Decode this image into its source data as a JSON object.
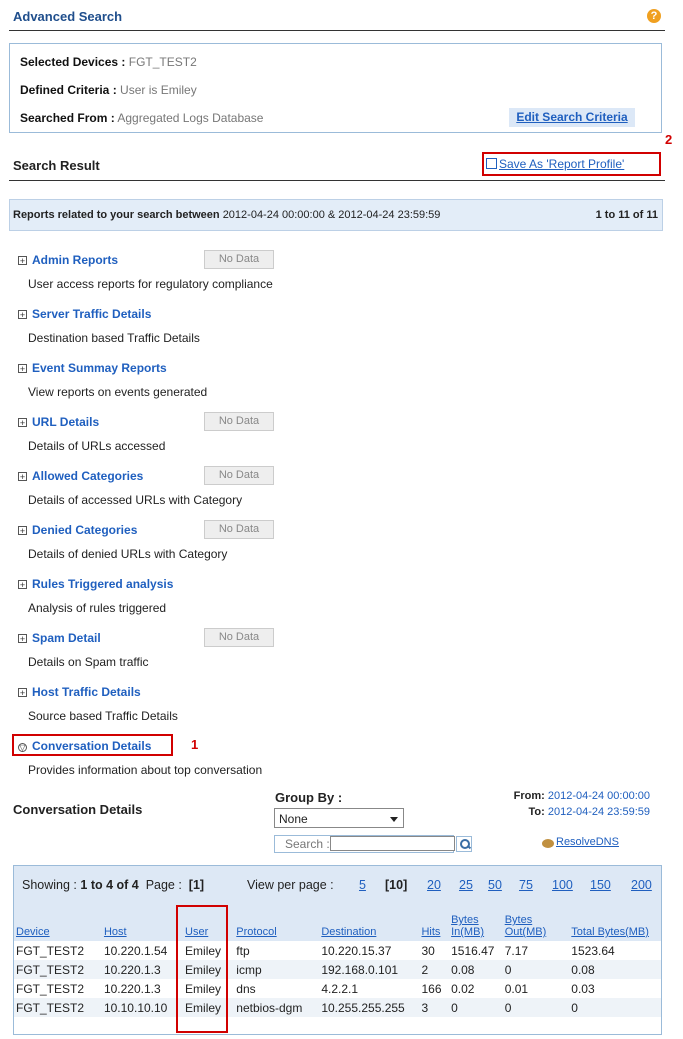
{
  "header": {
    "title": "Advanced Search",
    "help_icon": "?"
  },
  "criteria": {
    "devices_label": "Selected Devices :",
    "devices_value": "FGT_TEST2",
    "criteria_label": "Defined Criteria :",
    "criteria_value": "User is Emiley",
    "from_label": "Searched From :",
    "from_value": "Aggregated Logs Database",
    "edit_button": "Edit Search Criteria"
  },
  "search_result": {
    "title": "Search Result",
    "save_link": "Save  As  'Report  Profile'",
    "annotation_2": "2"
  },
  "band": {
    "prefix": "Reports related to your search between",
    "range": "2012-04-24 00:00:00 & 2012-04-24 23:59:59",
    "count": "1 to 11 of 11"
  },
  "reports": [
    {
      "name": "Admin Reports",
      "desc": "User access reports for regulatory compliance",
      "nodata": "No Data"
    },
    {
      "name": "Server Traffic Details",
      "desc": "Destination based Traffic Details",
      "nodata": ""
    },
    {
      "name": "Event Summay Reports",
      "desc": "View reports on events generated",
      "nodata": ""
    },
    {
      "name": "URL Details",
      "desc": "Details of URLs accessed",
      "nodata": "No Data"
    },
    {
      "name": "Allowed Categories",
      "desc": "Details of accessed URLs with Category",
      "nodata": "No Data"
    },
    {
      "name": "Denied Categories",
      "desc": "Details of denied URLs with Category",
      "nodata": "No Data"
    },
    {
      "name": "Rules Triggered analysis",
      "desc": "Analysis of rules triggered",
      "nodata": ""
    },
    {
      "name": "Spam Detail",
      "desc": "Details on Spam traffic",
      "nodata": "No Data"
    },
    {
      "name": "Host Traffic Details",
      "desc": "Source based Traffic Details",
      "nodata": ""
    }
  ],
  "conversation": {
    "name": "Conversation Details",
    "desc": "Provides information about top conversation",
    "annotation_1": "1",
    "section_title": "Conversation  Details",
    "group_by_label": "Group  By :",
    "group_by_value": "None",
    "from_label": "From:",
    "from_value": "2012-04-24  00:00:00",
    "to_label": "To:",
    "to_value": "2012-04-24  23:59:59",
    "search_label": "Search :",
    "resolve_dns": "ResolveDNS"
  },
  "pager": {
    "showing_label": "Showing :",
    "showing_value": "1 to 4 of 4",
    "page_label": "Page :",
    "page_value": "[1]",
    "view_label": "View per page :",
    "options": [
      "5",
      "[10]",
      "20",
      "25",
      "50",
      "75",
      "100",
      "150",
      "200"
    ]
  },
  "table": {
    "columns": [
      "Device",
      "Host",
      "User",
      "Protocol",
      "Destination",
      "Hits",
      "Bytes In(MB)",
      "Bytes Out(MB)",
      "Total Bytes(MB)"
    ],
    "rows": [
      [
        "FGT_TEST2",
        "10.220.1.54",
        "Emiley",
        "ftp",
        "10.220.15.37",
        "30",
        "1516.47",
        "7.17",
        "1523.64"
      ],
      [
        "FGT_TEST2",
        "10.220.1.3",
        "Emiley",
        "icmp",
        "192.168.0.101",
        "2",
        "0.08",
        "0",
        "0.08"
      ],
      [
        "FGT_TEST2",
        "10.220.1.3",
        "Emiley",
        "dns",
        "4.2.2.1",
        "166",
        "0.02",
        "0.01",
        "0.03"
      ],
      [
        "FGT_TEST2",
        "10.10.10.10",
        "Emiley",
        "netbios-dgm",
        "10.255.255.255",
        "3",
        "0",
        "0",
        "0"
      ]
    ]
  }
}
